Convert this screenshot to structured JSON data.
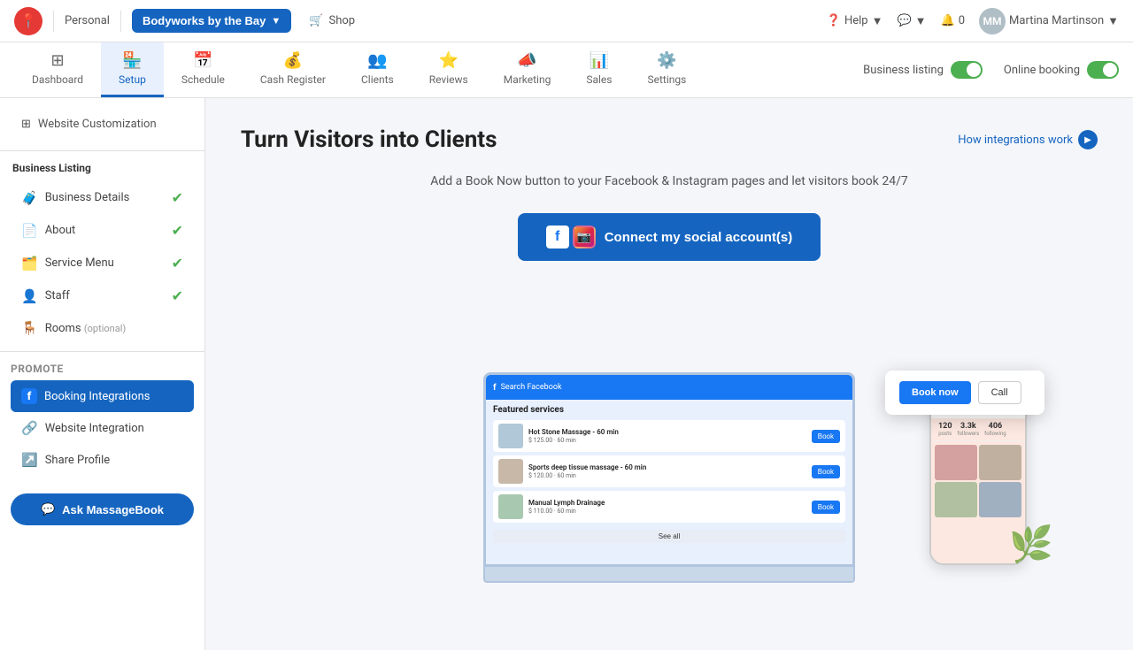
{
  "app": {
    "logo": "📍",
    "personal_label": "Personal",
    "business_name": "Bodyworks by the Bay",
    "shop_label": "Shop",
    "help_label": "Help",
    "notifications_count": "0",
    "user_name": "Martina Martinson"
  },
  "tabs": [
    {
      "id": "dashboard",
      "label": "Dashboard",
      "icon": "⊞"
    },
    {
      "id": "setup",
      "label": "Setup",
      "icon": "🏪",
      "active": true
    },
    {
      "id": "schedule",
      "label": "Schedule",
      "icon": "📅"
    },
    {
      "id": "cash-register",
      "label": "Cash Register",
      "icon": "💰"
    },
    {
      "id": "clients",
      "label": "Clients",
      "icon": "👥"
    },
    {
      "id": "reviews",
      "label": "Reviews",
      "icon": "⭐"
    },
    {
      "id": "marketing",
      "label": "Marketing",
      "icon": "📣"
    },
    {
      "id": "sales",
      "label": "Sales",
      "icon": "📊"
    },
    {
      "id": "settings",
      "label": "Settings",
      "icon": "⚙️"
    }
  ],
  "toggles": {
    "business_listing_label": "Business listing",
    "online_booking_label": "Online booking"
  },
  "sidebar": {
    "website_customization": "Website Customization",
    "business_listing_section": "Business Listing",
    "items": [
      {
        "id": "business-details",
        "label": "Business Details",
        "icon": "🧳",
        "checked": true
      },
      {
        "id": "about",
        "label": "About",
        "icon": "📄",
        "checked": true
      },
      {
        "id": "service-menu",
        "label": "Service Menu",
        "icon": "🗂️",
        "checked": true
      },
      {
        "id": "staff",
        "label": "Staff",
        "icon": "👤",
        "checked": true
      },
      {
        "id": "rooms",
        "label": "Rooms (optional)",
        "icon": "🪑",
        "checked": false
      }
    ],
    "promote_section": "Promote",
    "promote_items": [
      {
        "id": "booking-integrations",
        "label": "Booking Integrations",
        "icon": "f",
        "active": true
      },
      {
        "id": "website-integration",
        "label": "Website Integration",
        "icon": "🔗"
      },
      {
        "id": "share-profile",
        "label": "Share Profile",
        "icon": "↗️"
      }
    ],
    "ask_button": "Ask MassageBook"
  },
  "content": {
    "title": "Turn Visitors into Clients",
    "integration_link": "How integrations work",
    "subtitle": "Add a Book Now button to your Facebook & Instagram pages and let visitors book 24/7",
    "connect_button": "Connect my social account(s)",
    "services": [
      {
        "name": "Hot Stone Massage - 60 min",
        "price": "$ 125.00 · 60 min"
      },
      {
        "name": "Sports deep tissue massage - 60 min",
        "price": "$ 120.00 · 60 min"
      },
      {
        "name": "Manual Lymph Drainage",
        "price": "$ 110.00 · 60 min"
      }
    ],
    "featured_services_label": "Featured services",
    "see_all_label": "See all",
    "book_now_label": "Book now",
    "call_label": "Call",
    "book_label": "Book"
  }
}
